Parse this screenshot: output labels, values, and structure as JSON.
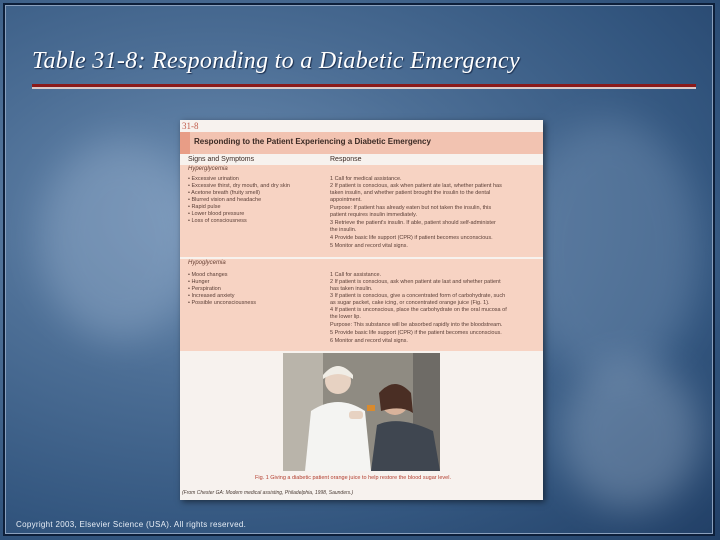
{
  "slide": {
    "title": "Table 31-8: Responding to a Diabetic Emergency",
    "copyright": "Copyright 2003, Elsevier Science (USA). All rights reserved."
  },
  "figure": {
    "tag": "31-8",
    "header": "Responding to the Patient Experiencing a Diabetic Emergency",
    "col_signs": "Signs and Symptoms",
    "col_response": "Response",
    "sections": [
      {
        "name": "Hyperglycemia",
        "signs": [
          "Excessive urination",
          "Excessive thirst, dry mouth, and dry skin",
          "Acetone breath (fruity smell)",
          "Blurred vision and headache",
          "Rapid pulse",
          "Lower blood pressure",
          "Loss of consciousness"
        ],
        "responses": [
          "1  Call for medical assistance.",
          "2  If patient is conscious, ask when patient ate last, whether patient has",
          "    taken insulin, and whether patient brought the insulin to the dental",
          "    appointment.",
          "    Purpose: If patient has already eaten but not taken the insulin, this",
          "    patient requires insulin immediately.",
          "3  Retrieve the patient's insulin. If able, patient should self-administer",
          "    the insulin.",
          "4  Provide basic life support (CPR) if patient becomes unconscious.",
          "5  Monitor and record vital signs."
        ]
      },
      {
        "name": "Hypoglycemia",
        "signs": [
          "Mood changes",
          "Hunger",
          "Perspiration",
          "Increased anxiety",
          "Possible unconsciousness"
        ],
        "responses": [
          "1  Call for assistance.",
          "2  If patient is conscious, ask when patient ate last and whether patient",
          "    has taken insulin.",
          "3  If patient is conscious, give a concentrated form of carbohydrate, such",
          "    as sugar packet, cake icing, or concentrated orange juice (Fig. 1).",
          "4  If patient is unconscious, place the carbohydrate on the oral mucosa of",
          "    the lower lip.",
          "    Purpose: This substance will be absorbed rapidly into the bloodstream.",
          "5  Provide basic life support (CPR) if the patient becomes unconscious.",
          "6  Monitor and record vital signs."
        ]
      }
    ],
    "caption": "Fig. 1  Giving a diabetic patient orange juice to help restore the blood sugar level.",
    "credit": "(From Chester GA: Modern medical assisting, Philadelphia, 1998, Saunders.)"
  }
}
